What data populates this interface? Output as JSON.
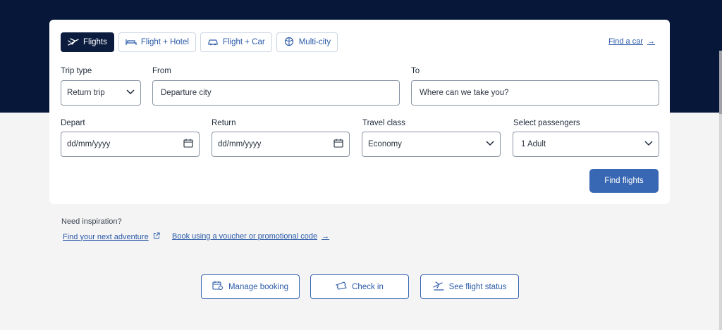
{
  "tabs": [
    {
      "label": "Flights",
      "icon": "plane-icon",
      "active": true
    },
    {
      "label": "Flight + Hotel",
      "icon": "bed-icon",
      "active": false
    },
    {
      "label": "Flight + Car",
      "icon": "car-icon",
      "active": false
    },
    {
      "label": "Multi-city",
      "icon": "globe-icon",
      "active": false
    }
  ],
  "find_car": "Find a car",
  "form": {
    "trip_type": {
      "label": "Trip type",
      "value": "Return trip"
    },
    "from": {
      "label": "From",
      "placeholder": "Departure city"
    },
    "to": {
      "label": "To",
      "placeholder": "Where can we take you?"
    },
    "depart": {
      "label": "Depart",
      "placeholder": "dd/mm/yyyy"
    },
    "return": {
      "label": "Return",
      "placeholder": "dd/mm/yyyy"
    },
    "travel_class": {
      "label": "Travel class",
      "value": "Economy"
    },
    "passengers": {
      "label": "Select passengers",
      "value": "1 Adult"
    },
    "submit": "Find flights"
  },
  "inspiration": {
    "title": "Need inspiration?",
    "links": [
      "Find your next adventure",
      "Book using a voucher or promotional code"
    ]
  },
  "quick_actions": [
    {
      "label": "Manage booking",
      "icon": "calendar-gear-icon"
    },
    {
      "label": "Check in",
      "icon": "ticket-icon"
    },
    {
      "label": "See flight status",
      "icon": "plane-status-icon"
    }
  ],
  "colors": {
    "hero": "#06173a",
    "accent": "#3867b3",
    "active_tab": "#0b1c3f",
    "link": "#2b5aa8"
  }
}
